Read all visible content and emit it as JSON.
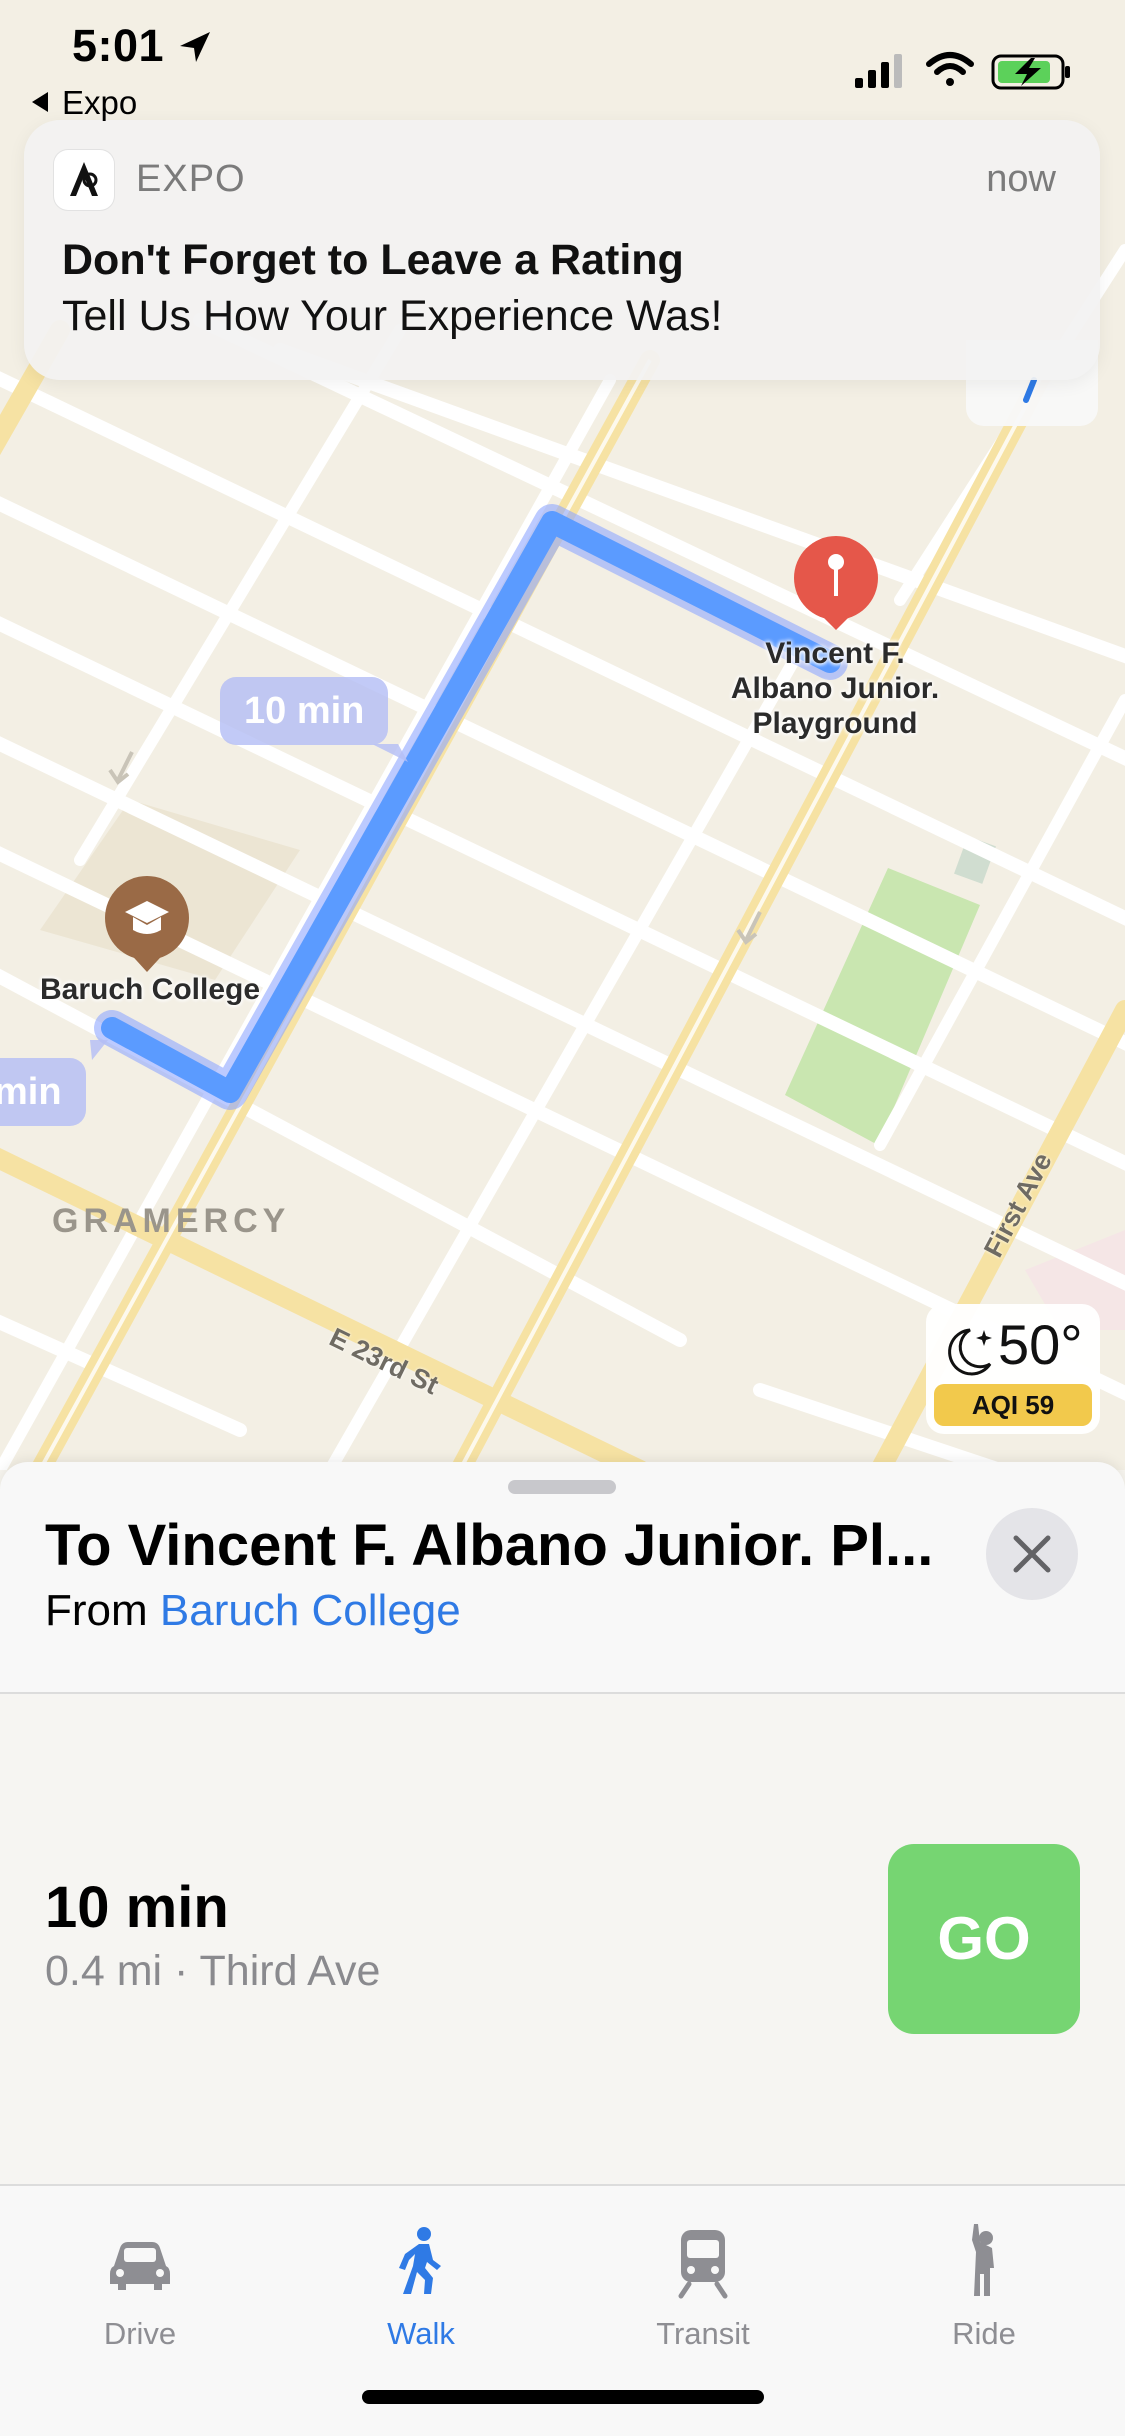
{
  "status_bar": {
    "time": "5:01",
    "back_app": "Expo"
  },
  "notification": {
    "app_name": "EXPO",
    "time": "now",
    "title": "Don't Forget to Leave a Rating",
    "body": "Tell Us How Your Experience Was!"
  },
  "map": {
    "eta_main": "10 min",
    "eta_alt": "min",
    "poi_destination": [
      "Vincent F.",
      "Albano Junior.",
      "Playground"
    ],
    "poi_origin": "Baruch College",
    "area_label": "GRAMERCY",
    "street_label_1": "E 23rd St",
    "street_label_2": "First Ave",
    "route_color": "#5b9bff"
  },
  "weather": {
    "temperature": "50°",
    "aqi": "AQI 59"
  },
  "route_sheet": {
    "title": "To Vincent F. Albano Junior. Pl...",
    "from_prefix": "From",
    "from_place": "Baruch College",
    "route_time": "10 min",
    "route_detail": "0.4 mi · Third Ave",
    "go_label": "GO"
  },
  "tabs": [
    {
      "label": "Drive",
      "icon": "car-icon",
      "active": false
    },
    {
      "label": "Walk",
      "icon": "walk-icon",
      "active": true
    },
    {
      "label": "Transit",
      "icon": "train-icon",
      "active": false
    },
    {
      "label": "Ride",
      "icon": "ride-icon",
      "active": false
    }
  ],
  "colors": {
    "accent": "#2f7ae5",
    "go_button": "#76d572",
    "pin": "#e5574a",
    "aqi_badge": "#f2c94c"
  }
}
